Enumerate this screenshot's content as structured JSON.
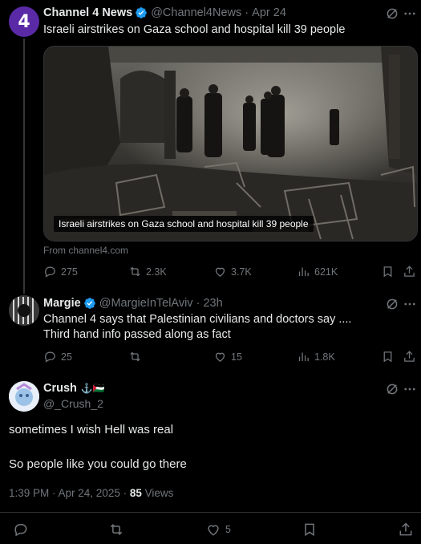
{
  "post1": {
    "author_name": "Channel 4 News",
    "handle": "@Channel4News",
    "date": "Apr 24",
    "text": "Israeli airstrikes on Gaza school and hospital kill 39 people",
    "media_caption": "Israeli airstrikes on Gaza school and hospital kill 39 people",
    "source": "From channel4.com",
    "avatar_glyph": "4",
    "avatar_color": "#5a2aa6",
    "replies": "275",
    "reposts": "2.3K",
    "likes": "3.7K",
    "views": "621K"
  },
  "post2": {
    "author_name": "Margie",
    "handle": "@MargieInTelAviv",
    "date": "23h",
    "text_line1": "Channel 4 says that Palestinian civilians and doctors say ....",
    "text_line2": "Third hand info passed along as fact",
    "replies": "25",
    "reposts": "",
    "likes": "15",
    "views": "1.8K"
  },
  "post3": {
    "author_name": "Crush",
    "name_emoji": "⚓🇵🇸",
    "handle": "@_Crush_2",
    "text_line1": "sometimes I wish Hell was real",
    "text_line2": "So people like you could go there",
    "time": "1:39 PM · Apr 24, 2025 · ",
    "views_count": "85",
    "views_label": " Views",
    "replies": "",
    "reposts": "",
    "likes": "5"
  },
  "colors": {
    "background": "#000000",
    "text": "#e7e9ea",
    "muted": "#71767b",
    "verified": "#1d9bf0",
    "divider": "#2f3336"
  },
  "icons": [
    "verified-icon",
    "grok-icon",
    "more-icon",
    "reply-icon",
    "repost-icon",
    "like-icon",
    "views-icon",
    "bookmark-icon",
    "share-icon"
  ]
}
